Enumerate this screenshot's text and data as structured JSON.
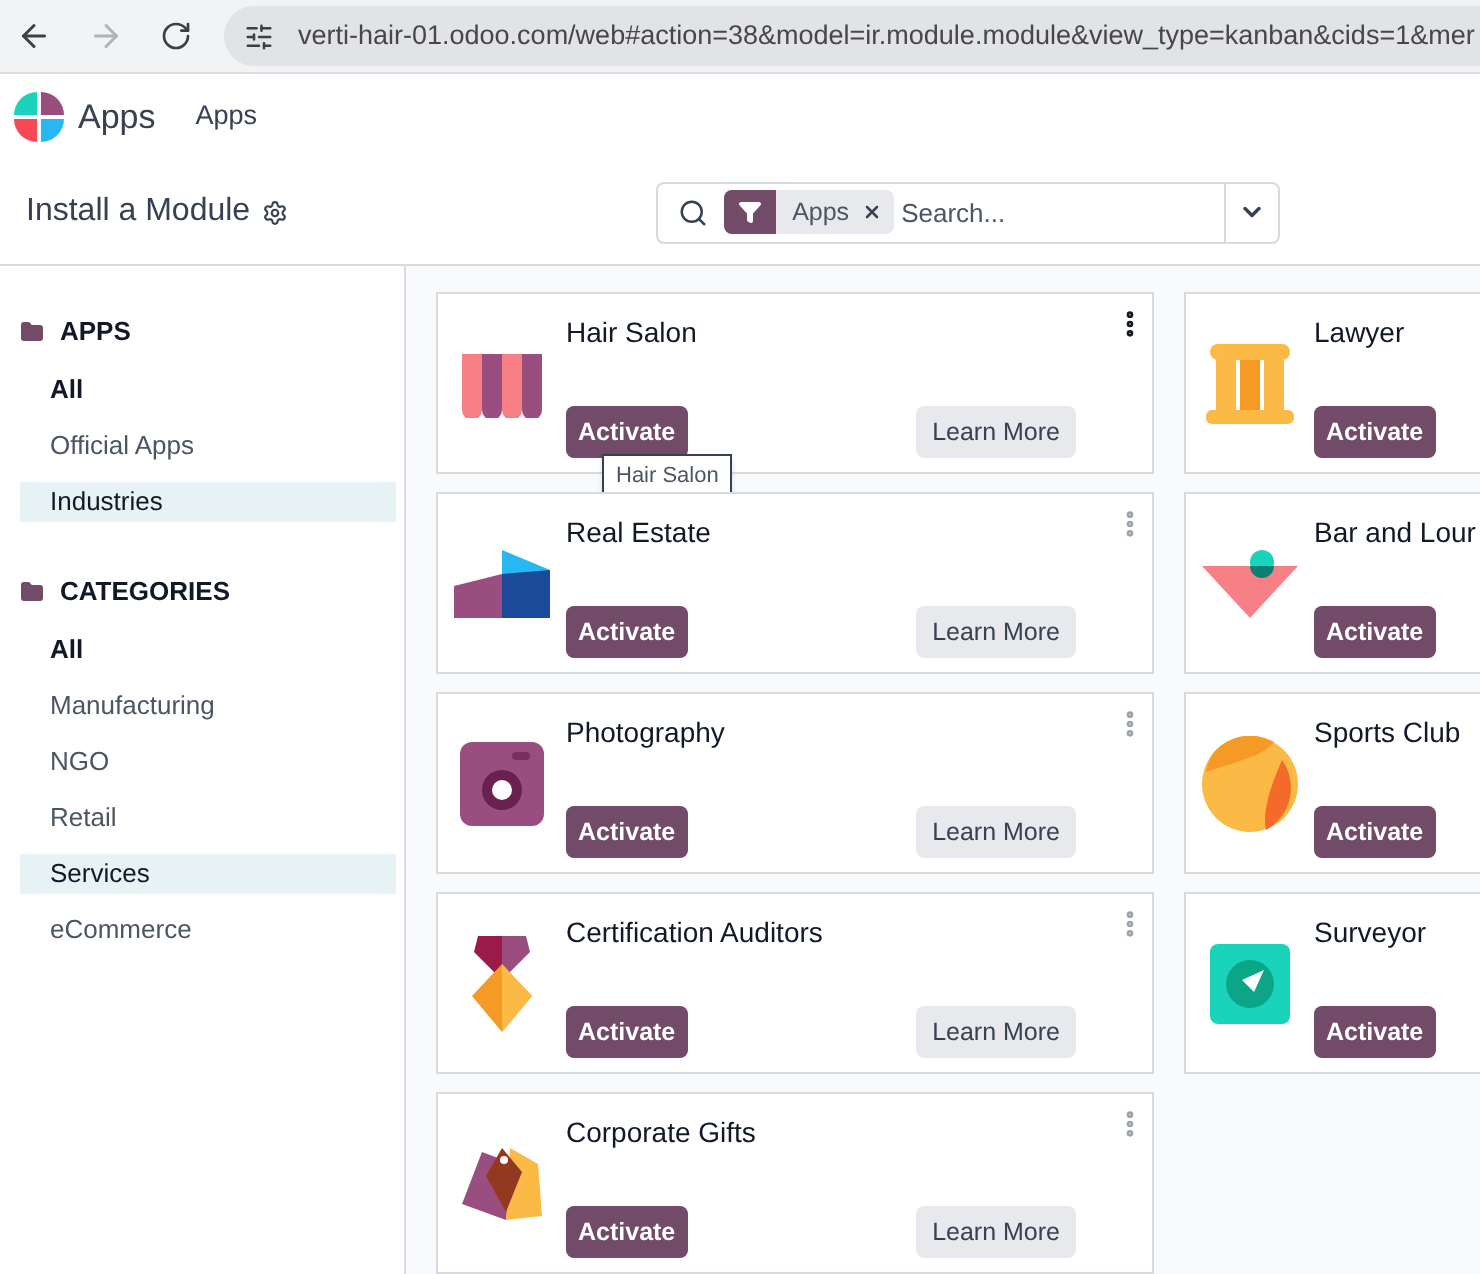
{
  "browser": {
    "url": "verti-hair-01.odoo.com/web#action=38&model=ir.module.module&view_type=kanban&cids=1&mer",
    "forward_disabled": true
  },
  "app_header": {
    "app_name": "Apps",
    "menu": [
      "Apps"
    ]
  },
  "control_panel": {
    "title": "Install a Module",
    "search": {
      "facet": "Apps",
      "placeholder": "Search..."
    }
  },
  "sidebar": [
    {
      "heading": "APPS",
      "items": [
        {
          "label": "All",
          "selected": false,
          "bold": true
        },
        {
          "label": "Official Apps",
          "selected": false,
          "bold": false
        },
        {
          "label": "Industries",
          "selected": true,
          "bold": false
        }
      ]
    },
    {
      "heading": "CATEGORIES",
      "items": [
        {
          "label": "All",
          "selected": false,
          "bold": true
        },
        {
          "label": "Manufacturing",
          "selected": false,
          "bold": false
        },
        {
          "label": "NGO",
          "selected": false,
          "bold": false
        },
        {
          "label": "Retail",
          "selected": false,
          "bold": false
        },
        {
          "label": "Services",
          "selected": true,
          "bold": false
        },
        {
          "label": "eCommerce",
          "selected": false,
          "bold": false
        }
      ]
    }
  ],
  "modules": [
    {
      "name": "Hair Salon",
      "activate": "Activate",
      "learn_more": "Learn More",
      "menu": true,
      "menu_hovered": true,
      "tooltip": "Hair Salon"
    },
    {
      "name": "Lawyer",
      "activate": "Activate"
    },
    {
      "name": "Real Estate",
      "activate": "Activate",
      "learn_more": "Learn More",
      "menu": true,
      "menu_hovered": false
    },
    {
      "name": "Bar and Lour",
      "activate": "Activate"
    },
    {
      "name": "Photography",
      "activate": "Activate",
      "learn_more": "Learn More",
      "menu": true,
      "menu_hovered": false
    },
    {
      "name": "Sports Club",
      "activate": "Activate"
    },
    {
      "name": "Certification Auditors",
      "activate": "Activate",
      "learn_more": "Learn More",
      "menu": true,
      "menu_hovered": false
    },
    {
      "name": "Surveyor",
      "activate": "Activate"
    },
    {
      "name": "Corporate Gifts",
      "activate": "Activate",
      "learn_more": "Learn More",
      "menu": true,
      "menu_hovered": false
    }
  ]
}
